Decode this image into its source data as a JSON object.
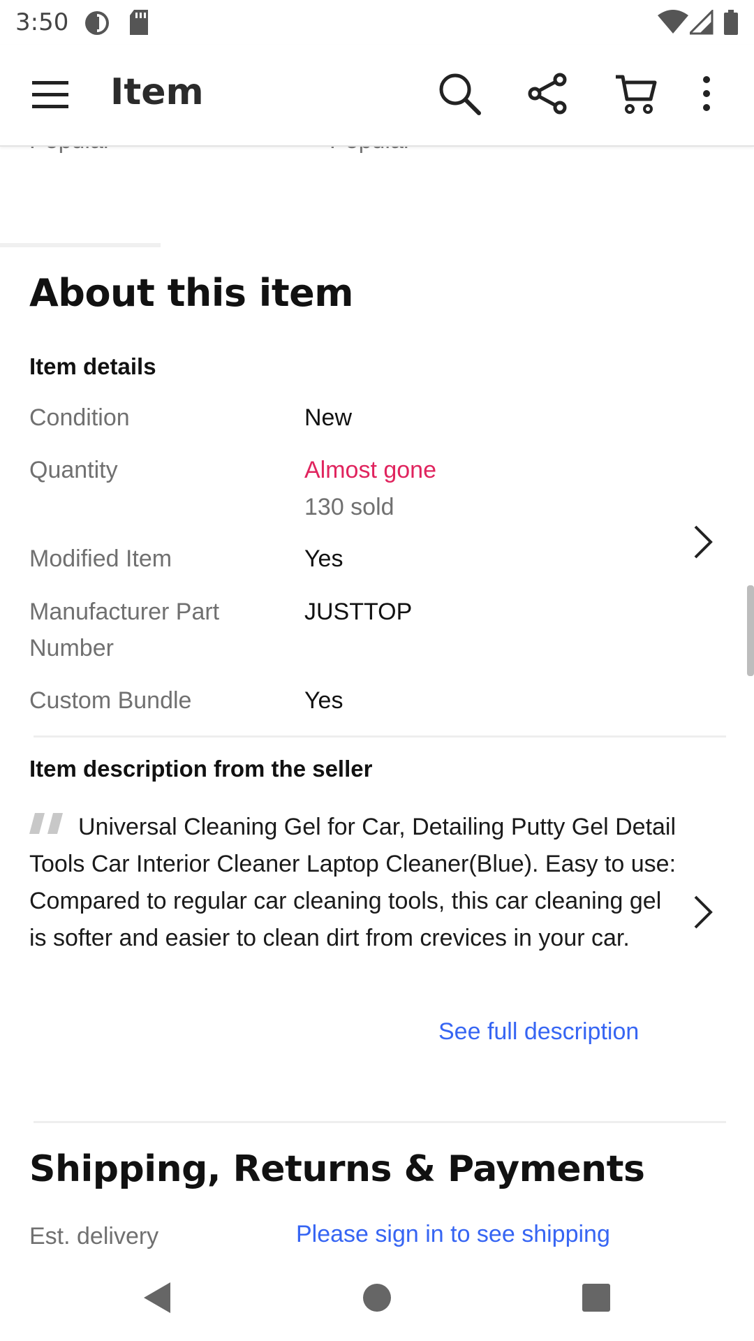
{
  "status_bar": {
    "time": "3:50",
    "icons": [
      "data-saver-icon",
      "sd-card-icon",
      "wifi-icon",
      "cell-signal-icon",
      "battery-icon"
    ]
  },
  "app_bar": {
    "title": "Item",
    "icons": [
      "menu-icon",
      "search-icon",
      "share-icon",
      "cart-icon",
      "more-vert-icon"
    ]
  },
  "top_cut": {
    "left": "Popular",
    "right": "Popular"
  },
  "about": {
    "title": "About this item",
    "details_title": "Item details",
    "rows": [
      {
        "label": "Condition",
        "value": "New"
      },
      {
        "label": "Quantity",
        "value": "Almost gone",
        "sub_value": "130 sold"
      },
      {
        "label": "Modified Item",
        "value": "Yes"
      },
      {
        "label": "Manufacturer Part Number",
        "value": "JUSTTOP"
      },
      {
        "label": "Custom Bundle",
        "value": "Yes"
      }
    ],
    "description_title": "Item description from the seller",
    "description": "Universal Cleaning Gel for Car, Detailing Putty Gel Detail Tools Car Interior Cleaner Laptop Cleaner(Blue). Easy to use: Compared to regular car cleaning tools, this car cleaning gel is softer and easier to clean dirt from crevices in your car.",
    "see_full": "See full description"
  },
  "shipping": {
    "title": "Shipping, Returns & Payments",
    "est_label": "Est. delivery",
    "sign_in_link": "Please sign in to see shipping"
  },
  "colors": {
    "alert": "#e0245e",
    "link": "#3665f3",
    "label_gray": "#707070"
  }
}
